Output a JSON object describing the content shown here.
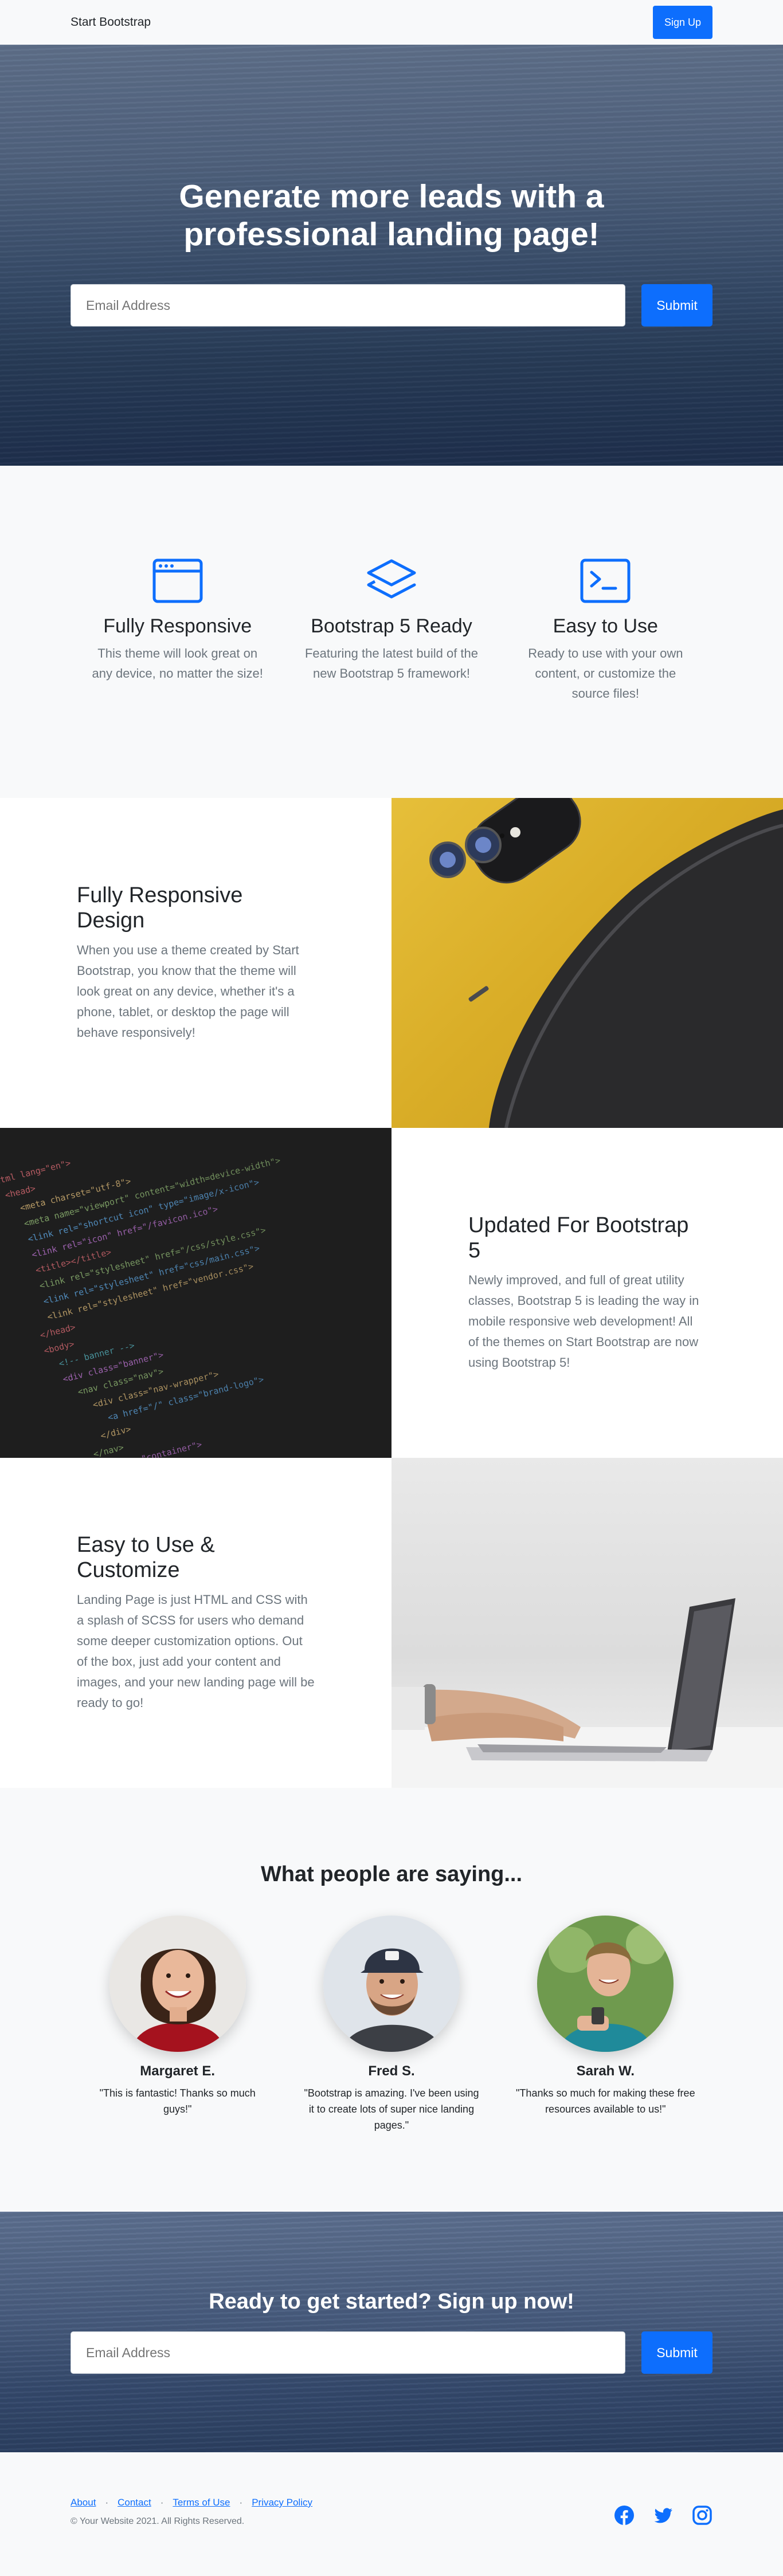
{
  "navbar": {
    "brand": "Start Bootstrap",
    "signup_label": "Sign Up"
  },
  "hero": {
    "heading": "Generate more leads with a professional landing page!",
    "email_placeholder": "Email Address",
    "submit_label": "Submit"
  },
  "features": [
    {
      "icon": "window-icon",
      "title": "Fully Responsive",
      "text": "This theme will look great on any device, no matter the size!"
    },
    {
      "icon": "layers-icon",
      "title": "Bootstrap 5 Ready",
      "text": "Featuring the latest build of the new Bootstrap 5 framework!"
    },
    {
      "icon": "terminal-icon",
      "title": "Easy to Use",
      "text": "Ready to use with your own content, or customize the source files!"
    }
  ],
  "showcases": [
    {
      "title": "Fully Responsive Design",
      "text": "When you use a theme created by Start Bootstrap, you know that the theme will look great on any device, whether it's a phone, tablet, or desktop the page will behave responsively!"
    },
    {
      "title": "Updated For Bootstrap 5",
      "text": "Newly improved, and full of great utility classes, Bootstrap 5 is leading the way in mobile responsive web development! All of the themes on Start Bootstrap are now using Bootstrap 5!"
    },
    {
      "title": "Easy to Use & Customize",
      "text": "Landing Page is just HTML and CSS with a splash of SCSS for users who demand some deeper customization options. Out of the box, just add your content and images, and your new landing page will be ready to go!"
    }
  ],
  "testimonials": {
    "heading": "What people are saying...",
    "items": [
      {
        "name": "Margaret E.",
        "quote": "\"This is fantastic! Thanks so much guys!\""
      },
      {
        "name": "Fred S.",
        "quote": "\"Bootstrap is amazing. I've been using it to create lots of super nice landing pages.\""
      },
      {
        "name": "Sarah W.",
        "quote": "\"Thanks so much for making these free resources available to us!\""
      }
    ]
  },
  "cta": {
    "heading": "Ready to get started? Sign up now!",
    "email_placeholder": "Email Address",
    "submit_label": "Submit"
  },
  "footer": {
    "links": [
      "About",
      "Contact",
      "Terms of Use",
      "Privacy Policy"
    ],
    "separator": "·",
    "copyright": "© Your Website 2021. All Rights Reserved.",
    "social_icons": [
      "facebook-icon",
      "twitter-icon",
      "instagram-icon"
    ]
  },
  "colors": {
    "primary": "#0d6efd",
    "light_bg": "#f8f9fa",
    "muted_text": "#6c757d"
  }
}
